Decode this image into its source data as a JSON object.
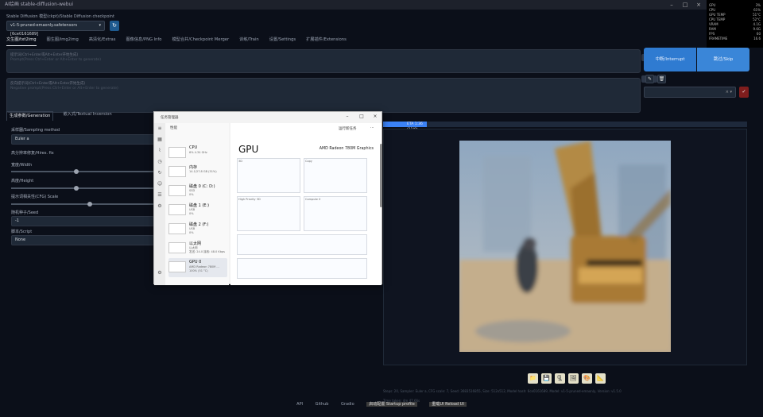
{
  "window": {
    "title": "AI绘画 stable-diffusion-webui"
  },
  "checkpoint": {
    "label": "Stable Diffusion 模型(ckpt)/Stable Diffusion checkpoint",
    "value": "v1-5-pruned-emaonly.safetensors [6ce0161689]"
  },
  "tabs": [
    "文生图/txt2img",
    "图生图/img2img",
    "高清化/Extras",
    "图像信息/PNG Info",
    "模型合并/Checkpoint Merger",
    "训练/Train",
    "设置/Settings",
    "扩展插件/Extensions"
  ],
  "prompt": {
    "placeholder": "提示词(Ctrl+Enter或Alt+Enter开始生成)",
    "placeholder_en": "Prompt(Press Ctrl+Enter or Alt+Enter to generate)",
    "count": "0/75"
  },
  "negative_prompt": {
    "placeholder": "反向提示词(Ctrl+Enter或Alt+Enter开始生成)",
    "placeholder_en": "Negative prompt(Press Ctrl+Enter or Alt+Enter to generate)",
    "count": "0/75"
  },
  "buttons": {
    "generate": "中断/Interrupt",
    "skip": "跳过/Skip",
    "refresh_icon": "↻",
    "pencil_icon": "✎",
    "trash_icon": "🗑",
    "style_apply_icon": "✓"
  },
  "styles": {
    "selector_value": "× ▾"
  },
  "subtabs": [
    "生成参数/Generation",
    "嵌入式/Textual Inversion"
  ],
  "params": {
    "sampler_label": "采样器/Sampling method",
    "sampler_value": "Euler a",
    "hires_label": "高分辨率修复/Hires. fix",
    "width_label": "宽度/Width",
    "height_label": "高度/Height",
    "cfg_label": "提示词相关性(CFG) Scale",
    "seed_label": "随机种子/Seed",
    "seed_value": "-1",
    "script_label": "脚本/Script",
    "script_value": "None"
  },
  "progress": {
    "text": "ETA 1:36 (11/0)",
    "fraction": 0.12
  },
  "image_tools": [
    "📁",
    "💾",
    "🗜",
    "🖼",
    "🎨",
    "📐"
  ],
  "info_line": "Steps: 20, Sampler: Euler a, CFG scale: 7, Seed: 3683516855, Size: 512x512, Model hash: 6ce0161689, Model: v1-5-pruned-emaonly, Version: v1.5.0",
  "time_line": "Time taken: 4m 47.66s",
  "footer": {
    "items": [
      "API",
      "Github",
      "Gradio",
      "启动配置 Startup profile",
      "重载UI Reload UI"
    ]
  },
  "overlay": {
    "rows": [
      [
        "GPU",
        "3%"
      ],
      [
        "CPU",
        "61%"
      ],
      [
        "GPU TEMP",
        "51°C"
      ],
      [
        "CPU TEMP",
        "52°C"
      ],
      [
        "VRAM",
        "4.1G"
      ],
      [
        "RAM",
        "9.6G"
      ],
      [
        "FPS",
        "60"
      ],
      [
        "FRAMETIME",
        "16.6"
      ]
    ]
  },
  "taskmgr": {
    "title": "任务管理器",
    "heading": "性能",
    "run_new_task": "运行新任务",
    "gpu_title": "GPU",
    "gpu_name": "AMD Radeon 780M Graphics",
    "items": [
      {
        "name": "CPU",
        "line1": "6%  4.34 GHz",
        "line2": ""
      },
      {
        "name": "内存",
        "line1": "14.1/27.8 GB (51%)",
        "line2": ""
      },
      {
        "name": "磁盘 0 (C: D:)",
        "line1": "SSD",
        "line2": "0%"
      },
      {
        "name": "磁盘 1 (E:)",
        "line1": "USB",
        "line2": "0%"
      },
      {
        "name": "磁盘 2 (F:)",
        "line1": "USB",
        "line2": "0%"
      },
      {
        "name": "以太网",
        "line1": "以太网",
        "line2": "发送: 24.0 接收: 48.0 Kbps"
      },
      {
        "name": "GPU 0",
        "line1": "AMD Radeon 780M ...",
        "line2": "100% (51 °C)"
      }
    ],
    "graphs": [
      "3D",
      "Copy",
      "High Priority 3D",
      "Compute 0",
      "",
      ""
    ]
  }
}
